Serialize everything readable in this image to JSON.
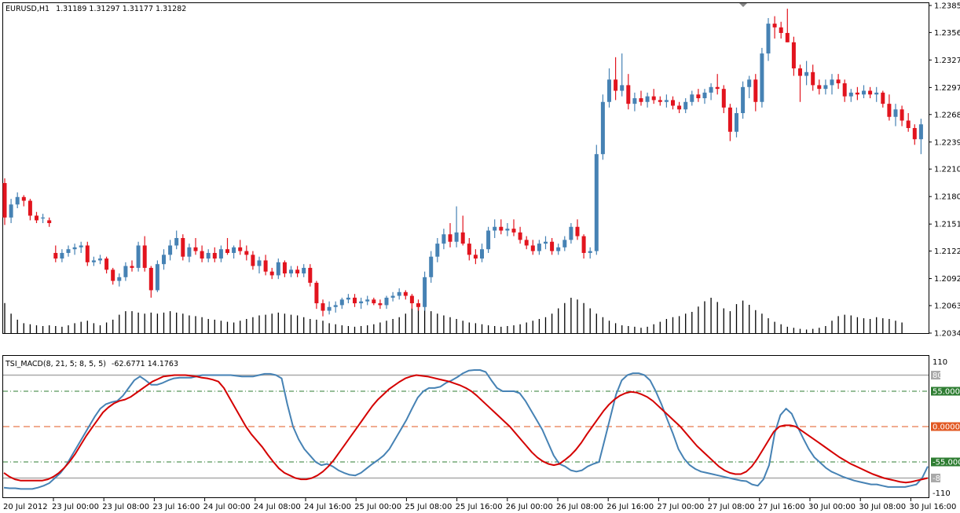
{
  "main_header": {
    "symbol_tf": "EURUSD,H1",
    "ohlc": "1.31189 1.31297 1.31177 1.31282"
  },
  "indicator_header": {
    "name": "TSI_MACD(8, 21, 5; 8, 5, 5)",
    "values": "-62.6771 14.1763"
  },
  "colors": {
    "bull": "#4682b4",
    "bear": "#e2141e",
    "tsi_line": "#4682b4",
    "signal_line": "#d40000",
    "level_55": "#2e7d32",
    "level_zero": "#e25822",
    "level_80": "#a9a9a9"
  },
  "price_axis": {
    "ticks": [
      "1.23855",
      "1.23565",
      "1.23270",
      "1.22975",
      "1.22685",
      "1.22390",
      "1.22100",
      "1.21805",
      "1.21510",
      "1.21220",
      "1.20925",
      "1.20635",
      "1.20340"
    ]
  },
  "indicator_axis": {
    "max_label": "110",
    "min_label": "-110",
    "level_labels": {
      "p80": "80",
      "p55": "55.0000",
      "zero": "0.0000",
      "m55": "-55.0000",
      "m80": "-80"
    }
  },
  "time_axis": {
    "labels": [
      "20 Jul 2012",
      "23 Jul 00:00",
      "23 Jul 08:00",
      "23 Jul 16:00",
      "24 Jul 00:00",
      "24 Jul 08:00",
      "24 Jul 16:00",
      "25 Jul 00:00",
      "25 Jul 08:00",
      "25 Jul 16:00",
      "26 Jul 00:00",
      "26 Jul 08:00",
      "26 Jul 16:00",
      "27 Jul 00:00",
      "27 Jul 08:00",
      "27 Jul 16:00",
      "30 Jul 00:00",
      "30 Jul 08:00",
      "30 Jul 16:00"
    ]
  },
  "chart_data": {
    "type": "line",
    "price_ylim": [
      1.2034,
      1.2388
    ],
    "candles_ohlc": [
      [
        1.2195,
        1.22,
        1.215,
        1.2158
      ],
      [
        1.2158,
        1.2178,
        1.2152,
        1.2172
      ],
      [
        1.2172,
        1.2185,
        1.2168,
        1.218
      ],
      [
        1.218,
        1.2182,
        1.217,
        1.2176
      ],
      [
        1.2176,
        1.2178,
        1.2155,
        1.216
      ],
      [
        1.216,
        1.2164,
        1.2152,
        1.2155
      ],
      [
        1.2157,
        1.2162,
        1.2152,
        1.2158
      ],
      [
        1.2155,
        1.2158,
        1.2148,
        1.2152
      ],
      [
        1.212,
        1.2128,
        1.211,
        1.2114
      ],
      [
        1.2114,
        1.2124,
        1.211,
        1.212
      ],
      [
        1.212,
        1.2128,
        1.2116,
        1.2124
      ],
      [
        1.2124,
        1.213,
        1.2118,
        1.2126
      ],
      [
        1.2126,
        1.2132,
        1.212,
        1.2128
      ],
      [
        1.2128,
        1.2132,
        1.2106,
        1.211
      ],
      [
        1.211,
        1.2116,
        1.2106,
        1.2112
      ],
      [
        1.2112,
        1.2118,
        1.2108,
        1.2114
      ],
      [
        1.2114,
        1.2116,
        1.2098,
        1.2102
      ],
      [
        1.2102,
        1.2104,
        1.2086,
        1.209
      ],
      [
        1.209,
        1.2098,
        1.2084,
        1.2094
      ],
      [
        1.2094,
        1.211,
        1.209,
        1.2106
      ],
      [
        1.2106,
        1.2112,
        1.21,
        1.2104
      ],
      [
        1.2104,
        1.2132,
        1.21,
        1.2128
      ],
      [
        1.2128,
        1.2138,
        1.21,
        1.2104
      ],
      [
        1.2104,
        1.2106,
        1.2072,
        1.208
      ],
      [
        1.208,
        1.2112,
        1.2078,
        1.2108
      ],
      [
        1.2108,
        1.2124,
        1.2102,
        1.2118
      ],
      [
        1.2118,
        1.2134,
        1.2112,
        1.2128
      ],
      [
        1.2128,
        1.2144,
        1.2124,
        1.2136
      ],
      [
        1.2136,
        1.214,
        1.2112,
        1.2116
      ],
      [
        1.2116,
        1.213,
        1.211,
        1.2126
      ],
      [
        1.2126,
        1.2136,
        1.2118,
        1.2122
      ],
      [
        1.2122,
        1.2128,
        1.211,
        1.2114
      ],
      [
        1.2114,
        1.2124,
        1.211,
        1.212
      ],
      [
        1.212,
        1.2126,
        1.211,
        1.2114
      ],
      [
        1.2114,
        1.2128,
        1.211,
        1.2124
      ],
      [
        1.2124,
        1.2136,
        1.2118,
        1.212
      ],
      [
        1.212,
        1.2128,
        1.2114,
        1.2126
      ],
      [
        1.2126,
        1.2134,
        1.2118,
        1.2122
      ],
      [
        1.2122,
        1.2128,
        1.2112,
        1.2118
      ],
      [
        1.2118,
        1.2122,
        1.2102,
        1.2106
      ],
      [
        1.2106,
        1.2116,
        1.2098,
        1.2112
      ],
      [
        1.2112,
        1.2118,
        1.2096,
        1.21
      ],
      [
        1.21,
        1.2104,
        1.2092,
        1.2096
      ],
      [
        1.2096,
        1.2114,
        1.2092,
        1.211
      ],
      [
        1.211,
        1.2112,
        1.2094,
        1.2098
      ],
      [
        1.2098,
        1.2106,
        1.2094,
        1.2102
      ],
      [
        1.2102,
        1.2106,
        1.2094,
        1.2098
      ],
      [
        1.2098,
        1.2108,
        1.2094,
        1.2104
      ],
      [
        1.2104,
        1.2108,
        1.2084,
        1.2088
      ],
      [
        1.2088,
        1.209,
        1.206,
        1.2066
      ],
      [
        1.2066,
        1.207,
        1.2052,
        1.2058
      ],
      [
        1.2058,
        1.2068,
        1.2054,
        1.2062
      ],
      [
        1.2062,
        1.2068,
        1.2056,
        1.2064
      ],
      [
        1.2064,
        1.2072,
        1.206,
        1.207
      ],
      [
        1.207,
        1.2076,
        1.2066,
        1.2072
      ],
      [
        1.2072,
        1.2076,
        1.2062,
        1.2066
      ],
      [
        1.2066,
        1.2072,
        1.206,
        1.2068
      ],
      [
        1.2068,
        1.2074,
        1.2064,
        1.207
      ],
      [
        1.207,
        1.2072,
        1.2064,
        1.2066
      ],
      [
        1.2066,
        1.207,
        1.206,
        1.2064
      ],
      [
        1.2064,
        1.2074,
        1.206,
        1.2072
      ],
      [
        1.2072,
        1.2078,
        1.2068,
        1.2074
      ],
      [
        1.2074,
        1.2082,
        1.207,
        1.2078
      ],
      [
        1.2078,
        1.208,
        1.207,
        1.2074
      ],
      [
        1.2074,
        1.2076,
        1.206,
        1.2066
      ],
      [
        1.2066,
        1.207,
        1.2058,
        1.2062
      ],
      [
        1.2062,
        1.21,
        1.2058,
        1.2094
      ],
      [
        1.2094,
        1.2122,
        1.2088,
        1.2116
      ],
      [
        1.2116,
        1.2136,
        1.211,
        1.213
      ],
      [
        1.213,
        1.2146,
        1.2124,
        1.214
      ],
      [
        1.214,
        1.2152,
        1.2126,
        1.2132
      ],
      [
        1.2132,
        1.217,
        1.2126,
        1.2142
      ],
      [
        1.2142,
        1.216,
        1.2128,
        1.213
      ],
      [
        1.213,
        1.2136,
        1.2112,
        1.2118
      ],
      [
        1.2118,
        1.2124,
        1.2108,
        1.2114
      ],
      [
        1.2114,
        1.213,
        1.211,
        1.2124
      ],
      [
        1.2124,
        1.2148,
        1.212,
        1.2144
      ],
      [
        1.2144,
        1.2156,
        1.2136,
        1.2148
      ],
      [
        1.2148,
        1.2156,
        1.214,
        1.2144
      ],
      [
        1.2144,
        1.2152,
        1.2138,
        1.2146
      ],
      [
        1.2146,
        1.2156,
        1.2138,
        1.2142
      ],
      [
        1.2142,
        1.2148,
        1.213,
        1.2134
      ],
      [
        1.2134,
        1.2138,
        1.2124,
        1.2128
      ],
      [
        1.2128,
        1.2134,
        1.2118,
        1.2122
      ],
      [
        1.2122,
        1.2134,
        1.2118,
        1.213
      ],
      [
        1.213,
        1.2138,
        1.2124,
        1.2132
      ],
      [
        1.2132,
        1.2136,
        1.2118,
        1.2122
      ],
      [
        1.2122,
        1.213,
        1.2118,
        1.2126
      ],
      [
        1.2126,
        1.2138,
        1.2122,
        1.2134
      ],
      [
        1.2134,
        1.2152,
        1.213,
        1.2148
      ],
      [
        1.2148,
        1.2156,
        1.2134,
        1.2138
      ],
      [
        1.2138,
        1.214,
        1.2114,
        1.212
      ],
      [
        1.212,
        1.2126,
        1.2114,
        1.2122
      ],
      [
        1.2122,
        1.2236,
        1.2118,
        1.2226
      ],
      [
        1.2226,
        1.229,
        1.222,
        1.2282
      ],
      [
        1.2282,
        1.2318,
        1.2276,
        1.2306
      ],
      [
        1.2306,
        1.233,
        1.2284,
        1.2294
      ],
      [
        1.2294,
        1.2334,
        1.2288,
        1.23
      ],
      [
        1.23,
        1.2312,
        1.2274,
        1.228
      ],
      [
        1.228,
        1.2292,
        1.2272,
        1.2286
      ],
      [
        1.2286,
        1.2294,
        1.2278,
        1.2282
      ],
      [
        1.2282,
        1.2292,
        1.2276,
        1.2288
      ],
      [
        1.2288,
        1.2296,
        1.228,
        1.2284
      ],
      [
        1.2284,
        1.2288,
        1.2278,
        1.2282
      ],
      [
        1.2282,
        1.229,
        1.2276,
        1.2284
      ],
      [
        1.2284,
        1.2288,
        1.2274,
        1.2278
      ],
      [
        1.2278,
        1.2282,
        1.227,
        1.2274
      ],
      [
        1.2274,
        1.2286,
        1.227,
        1.2282
      ],
      [
        1.2282,
        1.2294,
        1.2278,
        1.229
      ],
      [
        1.229,
        1.2296,
        1.2282,
        1.2286
      ],
      [
        1.2286,
        1.2296,
        1.228,
        1.2292
      ],
      [
        1.2292,
        1.2302,
        1.2284,
        1.2298
      ],
      [
        1.2298,
        1.2312,
        1.229,
        1.2296
      ],
      [
        1.2296,
        1.23,
        1.227,
        1.2276
      ],
      [
        1.2276,
        1.228,
        1.224,
        1.225
      ],
      [
        1.225,
        1.2276,
        1.2244,
        1.227
      ],
      [
        1.227,
        1.2304,
        1.2264,
        1.2298
      ],
      [
        1.2298,
        1.231,
        1.2286,
        1.2306
      ],
      [
        1.2306,
        1.2312,
        1.2272,
        1.2282
      ],
      [
        1.2282,
        1.234,
        1.2276,
        1.2334
      ],
      [
        1.2334,
        1.2372,
        1.2326,
        1.2366
      ],
      [
        1.2366,
        1.2374,
        1.235,
        1.2362
      ],
      [
        1.2362,
        1.2368,
        1.235,
        1.2356
      ],
      [
        1.2356,
        1.2382,
        1.2346,
        1.2346
      ],
      [
        1.2346,
        1.2352,
        1.231,
        1.2318
      ],
      [
        1.2318,
        1.2322,
        1.2282,
        1.231
      ],
      [
        1.231,
        1.2326,
        1.23,
        1.2314
      ],
      [
        1.2314,
        1.2322,
        1.2294,
        1.23
      ],
      [
        1.23,
        1.2306,
        1.229,
        1.2296
      ],
      [
        1.2296,
        1.2306,
        1.229,
        1.23
      ],
      [
        1.23,
        1.2312,
        1.229,
        1.2306
      ],
      [
        1.2306,
        1.2312,
        1.2296,
        1.2302
      ],
      [
        1.2302,
        1.2306,
        1.2282,
        1.2288
      ],
      [
        1.2288,
        1.2296,
        1.2282,
        1.2292
      ],
      [
        1.2292,
        1.2298,
        1.2284,
        1.229
      ],
      [
        1.229,
        1.23,
        1.2286,
        1.2294
      ],
      [
        1.2294,
        1.2298,
        1.2286,
        1.229
      ],
      [
        1.229,
        1.2298,
        1.2282,
        1.2292
      ],
      [
        1.2292,
        1.2294,
        1.2276,
        1.228
      ],
      [
        1.228,
        1.229,
        1.2262,
        1.2266
      ],
      [
        1.2266,
        1.228,
        1.2256,
        1.2274
      ],
      [
        1.2274,
        1.2278,
        1.2256,
        1.2262
      ],
      [
        1.2262,
        1.227,
        1.225,
        1.2254
      ],
      [
        1.2254,
        1.2258,
        1.2236,
        1.2242
      ],
      [
        1.2242,
        1.2264,
        1.2226,
        1.2258
      ],
      [
        1.2258,
        1.2262,
        1.2238,
        1.2244
      ],
      [
        1.2244,
        1.2258,
        1.2232,
        1.225
      ],
      [
        1.225,
        1.2266,
        1.224,
        1.2262
      ]
    ],
    "volume_relative": [
      0.85,
      0.55,
      0.38,
      0.28,
      0.25,
      0.22,
      0.2,
      0.22,
      0.2,
      0.18,
      0.22,
      0.28,
      0.32,
      0.35,
      0.28,
      0.22,
      0.3,
      0.38,
      0.52,
      0.62,
      0.62,
      0.58,
      0.55,
      0.58,
      0.55,
      0.58,
      0.62,
      0.58,
      0.55,
      0.5,
      0.48,
      0.45,
      0.4,
      0.38,
      0.35,
      0.32,
      0.3,
      0.35,
      0.4,
      0.45,
      0.5,
      0.52,
      0.55,
      0.58,
      0.55,
      0.52,
      0.5,
      0.45,
      0.4,
      0.38,
      0.35,
      0.28,
      0.25,
      0.22,
      0.2,
      0.18,
      0.2,
      0.22,
      0.25,
      0.3,
      0.35,
      0.4,
      0.45,
      0.55,
      0.7,
      0.85,
      0.75,
      0.62,
      0.55,
      0.5,
      0.45,
      0.4,
      0.35,
      0.3,
      0.28,
      0.25,
      0.22,
      0.2,
      0.18,
      0.2,
      0.22,
      0.25,
      0.3,
      0.35,
      0.4,
      0.45,
      0.55,
      0.7,
      0.85,
      1.0,
      0.95,
      0.85,
      0.7,
      0.55,
      0.45,
      0.35,
      0.28,
      0.22,
      0.2,
      0.18,
      0.15,
      0.18,
      0.25,
      0.32,
      0.4,
      0.45,
      0.48,
      0.55,
      0.6,
      0.75,
      0.9,
      1.0,
      0.88,
      0.7,
      0.62,
      0.82,
      0.92,
      0.8,
      0.65,
      0.55,
      0.42,
      0.32,
      0.25,
      0.18,
      0.15,
      0.12,
      0.1,
      0.12,
      0.15,
      0.2,
      0.35,
      0.48,
      0.52,
      0.5,
      0.45,
      0.42,
      0.4,
      0.45,
      0.42,
      0.4,
      0.35,
      0.3
    ],
    "indicator_ylim": [
      -110,
      110
    ],
    "levels": [
      80,
      55,
      0,
      -55,
      -80
    ],
    "tsi": [
      -95,
      -96,
      -96,
      -97,
      -97,
      -97,
      -95,
      -92,
      -88,
      -80,
      -72,
      -60,
      -45,
      -30,
      -15,
      0,
      15,
      28,
      35,
      38,
      40,
      48,
      60,
      72,
      78,
      72,
      65,
      65,
      68,
      72,
      75,
      76,
      76,
      76,
      78,
      80,
      80,
      80,
      80,
      80,
      80,
      79,
      78,
      78,
      78,
      80,
      82,
      82,
      80,
      75,
      35,
      0,
      -20,
      -35,
      -45,
      -55,
      -60,
      -58,
      -62,
      -68,
      -72,
      -75,
      -76,
      -72,
      -65,
      -58,
      -52,
      -45,
      -35,
      -20,
      -5,
      10,
      28,
      45,
      55,
      60,
      60,
      62,
      68,
      72,
      77,
      83,
      87,
      88,
      88,
      85,
      72,
      60,
      55,
      55,
      55,
      52,
      40,
      25,
      10,
      -5,
      -25,
      -45,
      -58,
      -62,
      -68,
      -70,
      -68,
      -62,
      -58,
      -55,
      -20,
      15,
      50,
      72,
      80,
      83,
      83,
      80,
      72,
      55,
      35,
      12,
      -10,
      -35,
      -50,
      -60,
      -66,
      -70,
      -72,
      -74,
      -76,
      -78,
      -80,
      -82,
      -84,
      -85,
      -90,
      -92,
      -82,
      -60,
      -10,
      18,
      28,
      20,
      0,
      -18,
      -35,
      -48,
      -56,
      -64,
      -70,
      -74,
      -78,
      -81,
      -84,
      -86,
      -88,
      -90,
      -90,
      -92,
      -94,
      -94,
      -94,
      -94,
      -92,
      -90,
      -80,
      -62
    ],
    "signal": [
      -72,
      -78,
      -82,
      -84,
      -84,
      -84,
      -84,
      -84,
      -82,
      -78,
      -72,
      -64,
      -54,
      -42,
      -28,
      -14,
      -2,
      10,
      22,
      30,
      36,
      40,
      42,
      46,
      52,
      58,
      64,
      70,
      74,
      78,
      79,
      80,
      80,
      80,
      79,
      78,
      76,
      75,
      73,
      70,
      60,
      45,
      30,
      15,
      0,
      -12,
      -22,
      -32,
      -44,
      -55,
      -65,
      -72,
      -76,
      -80,
      -82,
      -82,
      -80,
      -76,
      -70,
      -62,
      -52,
      -40,
      -28,
      -16,
      -4,
      8,
      20,
      32,
      42,
      50,
      58,
      64,
      70,
      75,
      78,
      80,
      79,
      78,
      76,
      74,
      72,
      70,
      67,
      64,
      60,
      55,
      48,
      40,
      32,
      24,
      16,
      8,
      0,
      -10,
      -20,
      -30,
      -40,
      -48,
      -54,
      -58,
      -60,
      -58,
      -52,
      -45,
      -36,
      -25,
      -12,
      0,
      12,
      24,
      34,
      42,
      48,
      52,
      54,
      53,
      50,
      46,
      40,
      32,
      24,
      16,
      8,
      0,
      -10,
      -20,
      -30,
      -38,
      -46,
      -54,
      -62,
      -68,
      -72,
      -74,
      -74,
      -70,
      -62,
      -50,
      -36,
      -22,
      -8,
      0,
      2,
      2,
      0,
      -6,
      -12,
      -18,
      -24,
      -30,
      -36,
      -42,
      -48,
      -53,
      -58,
      -62,
      -66,
      -70,
      -74,
      -77,
      -80,
      -82,
      -84,
      -86,
      -87,
      -86,
      -84,
      -82,
      -80
    ]
  }
}
